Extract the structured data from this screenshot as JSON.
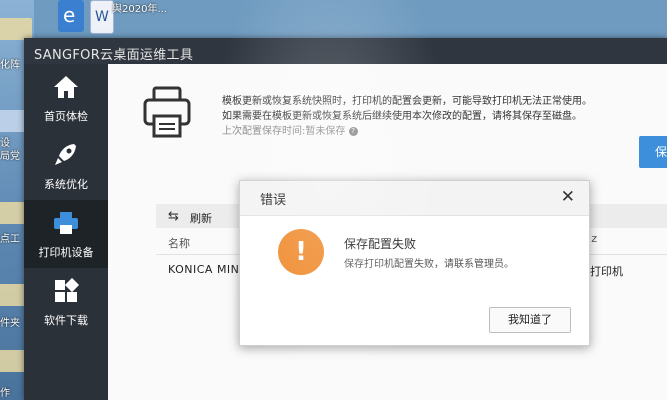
{
  "desktop": {
    "top_label": "與2020年...",
    "left_labels": [
      "化阵",
      "设",
      "局党",
      "点工",
      "件夹",
      "作"
    ]
  },
  "window": {
    "title": "SANGFOR云桌面运维工具"
  },
  "sidebar": {
    "items": [
      {
        "label": "首页体检",
        "icon": "home-icon"
      },
      {
        "label": "系统优化",
        "icon": "rocket-icon"
      },
      {
        "label": "打印机设备",
        "icon": "printer-icon"
      },
      {
        "label": "软件下载",
        "icon": "apps-icon"
      }
    ],
    "active_index": 2
  },
  "notice": {
    "line1": "模板更新或恢复系统快照时，打印机的配置会更新，可能导致打印机无法正常使用。",
    "line2": "如果需要在模板更新或恢复系统后继续使用本次修改的配置，请将其保存至磁盘。",
    "line3": "上次配置保存时间:暂未保存"
  },
  "save_button": {
    "label": "保"
  },
  "toolbar": {
    "refresh_label": "刷新"
  },
  "table": {
    "header_name": "名称",
    "header_right": "z",
    "rows": [
      {
        "name": "KONICA MINOLT",
        "right": "打印机"
      }
    ]
  },
  "modal": {
    "title": "错误",
    "heading": "保存配置失败",
    "message": "保存打印机配置失败，请联系管理员。",
    "ok_label": "我知道了"
  },
  "colors": {
    "sidebar": "#2b3138",
    "titlebar": "#2f3640",
    "accent": "#3d8fdc",
    "warning": "#ef8a2c"
  }
}
